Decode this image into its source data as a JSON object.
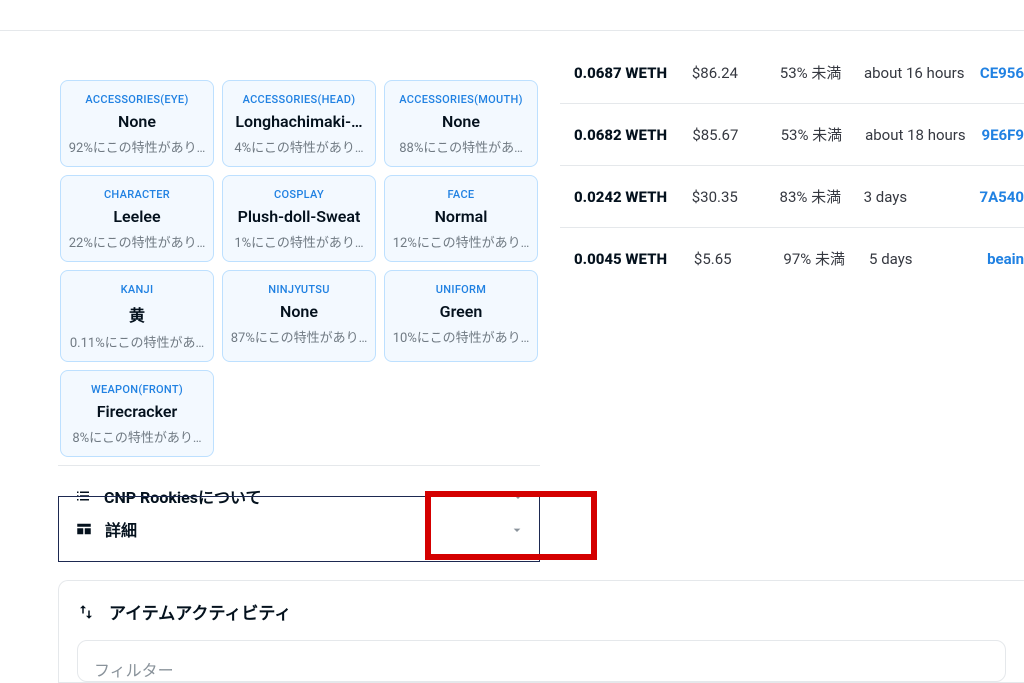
{
  "traits": [
    {
      "type": "ACCESSORIES(EYE)",
      "value": "None",
      "pct": "92%にこの特性があり…"
    },
    {
      "type": "ACCESSORIES(HEAD)",
      "value": "Longhachimaki-…",
      "pct": "4%にこの特性があり…"
    },
    {
      "type": "ACCESSORIES(MOUTH)",
      "value": "None",
      "pct": "88%にこの特性があ…"
    },
    {
      "type": "CHARACTER",
      "value": "Leelee",
      "pct": "22%にこの特性があり…"
    },
    {
      "type": "COSPLAY",
      "value": "Plush-doll-Sweat",
      "pct": "1%にこの特性があり…"
    },
    {
      "type": "FACE",
      "value": "Normal",
      "pct": "12%にこの特性があり…"
    },
    {
      "type": "KANJI",
      "value": "黄",
      "pct": "0.11%にこの特性があ…"
    },
    {
      "type": "NINJYUTSU",
      "value": "None",
      "pct": "87%にこの特性があり…"
    },
    {
      "type": "UNIFORM",
      "value": "Green",
      "pct": "10%にこの特性があり…"
    },
    {
      "type": "WEAPON(FRONT)",
      "value": "Firecracker",
      "pct": "8%にこの特性があり…"
    }
  ],
  "accordion": {
    "about_label": "CNP Rookiesについて",
    "details_label": "詳細"
  },
  "activity": {
    "title": "アイテムアクティビティ",
    "filter_placeholder": "フィルター"
  },
  "offers": [
    {
      "price": "0.0687 WETH",
      "usd": "$86.24",
      "floor": "53% 未満",
      "exp": "about 16 hours",
      "from": "CE956"
    },
    {
      "price": "0.0682 WETH",
      "usd": "$85.67",
      "floor": "53% 未満",
      "exp": "about 18 hours",
      "from": "9E6F9"
    },
    {
      "price": "0.0242 WETH",
      "usd": "$30.35",
      "floor": "83% 未満",
      "exp": "3 days",
      "from": "7A540"
    },
    {
      "price": "0.0045 WETH",
      "usd": "$5.65",
      "floor": "97% 未満",
      "exp": "5 days",
      "from": "beain"
    }
  ]
}
